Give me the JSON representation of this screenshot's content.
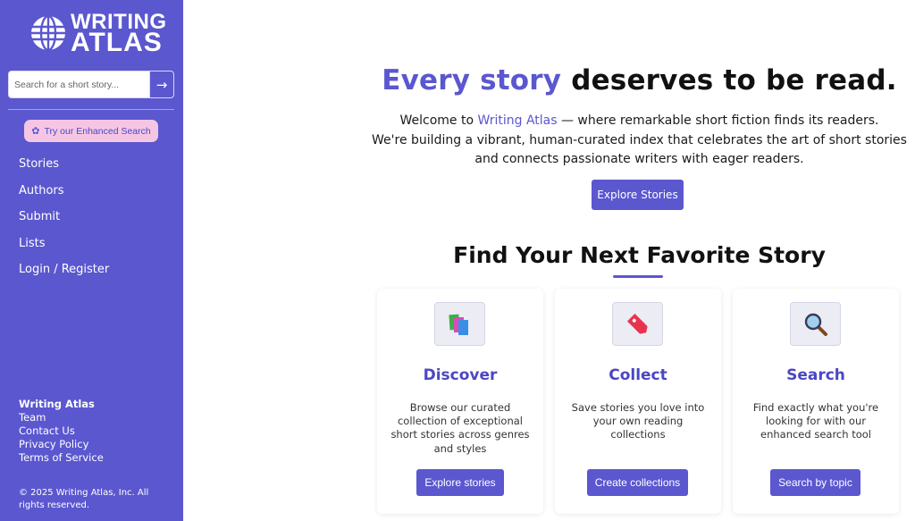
{
  "brand": {
    "line1": "WRITING",
    "line2": "ATLAS"
  },
  "sidebar": {
    "search_placeholder": "Search for a short story...",
    "search_button": "→",
    "enhanced_search": "Try our Enhanced Search",
    "nav": [
      "Stories",
      "Authors",
      "Submit",
      "Lists",
      "Login / Register"
    ],
    "footer": {
      "brand": "Writing Atlas",
      "links": [
        "Team",
        "Contact Us",
        "Privacy Policy",
        "Terms of Service"
      ],
      "copyright": "© 2025 Writing Atlas, Inc. All rights reserved."
    }
  },
  "hero": {
    "title_accent": "Every story",
    "title_rest": "deserves to be read.",
    "desc_pre": "Welcome to ",
    "desc_link": "Writing Atlas",
    "desc_post": " — where remarkable short fiction finds its readers.",
    "desc_line2": "We're building a vibrant, human-curated index that celebrates the art of short stories",
    "desc_line3": "and connects passionate writers with eager readers.",
    "cta": "Explore Stories"
  },
  "features": {
    "title": "Find Your Next Favorite Story",
    "cards": [
      {
        "icon": "books-icon",
        "title": "Discover",
        "desc": "Browse our curated collection of exceptional short stories across genres and styles",
        "button": "Explore stories"
      },
      {
        "icon": "bookmark-tag-icon",
        "title": "Collect",
        "desc": "Save stories you love into your own reading collections",
        "button": "Create collections"
      },
      {
        "icon": "magnifier-icon",
        "title": "Search",
        "desc": "Find exactly what you're looking for with our enhanced search tool",
        "button": "Search by topic"
      }
    ]
  },
  "colors": {
    "accent": "#5b57cf",
    "pink": "#f5c6e4"
  }
}
